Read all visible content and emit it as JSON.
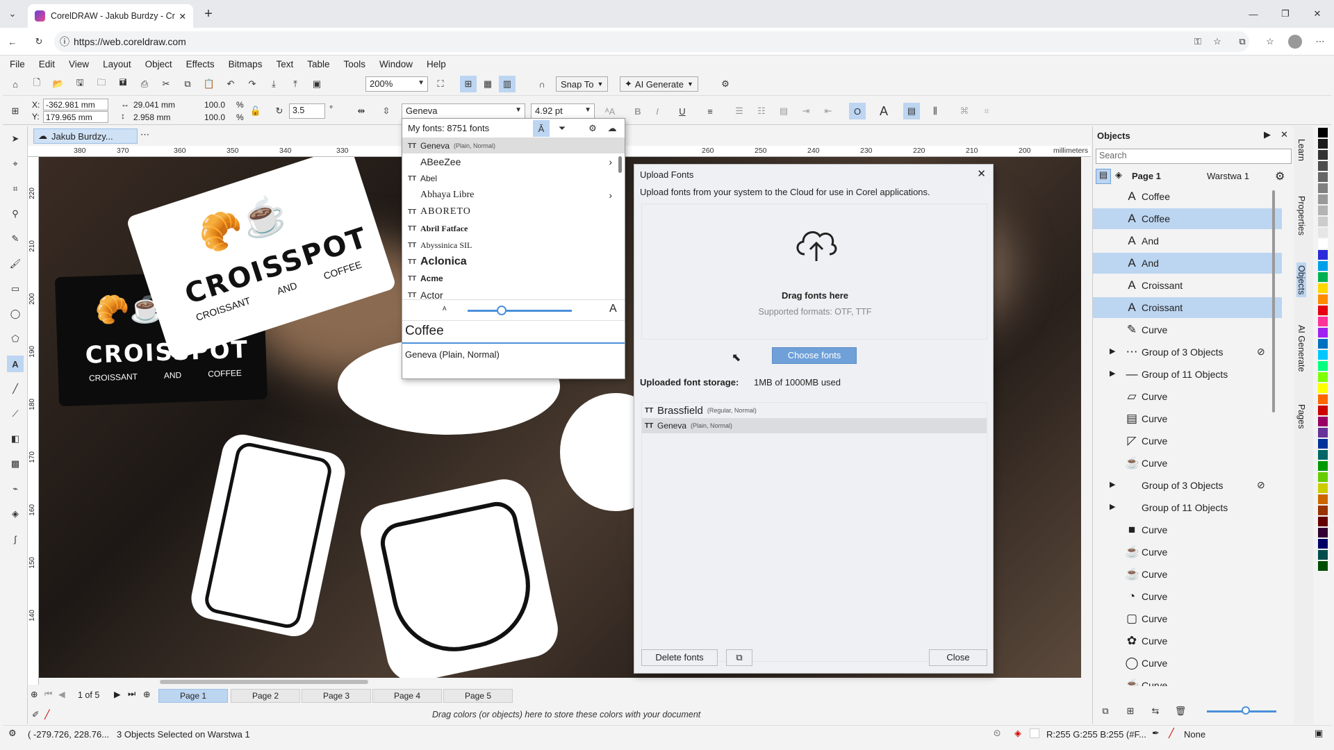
{
  "browser": {
    "tab_title": "CorelDRAW - Jakub Burdzy - Crois",
    "url": "https://web.coreldraw.com"
  },
  "menu": [
    "File",
    "Edit",
    "View",
    "Layout",
    "Object",
    "Effects",
    "Bitmaps",
    "Text",
    "Table",
    "Tools",
    "Window",
    "Help"
  ],
  "toolbar": {
    "zoom": "200%",
    "snap": "Snap To",
    "ai_generate": "AI Generate"
  },
  "propbar": {
    "x": "-362.981 mm",
    "y": "179.965 mm",
    "w": "29.041 mm",
    "h": "2.958 mm",
    "sx": "100.0",
    "sy": "100.0",
    "pct": "%",
    "rotation": "3.5",
    "deg": "°",
    "font": "Geneva",
    "size": "4.92 pt"
  },
  "doc_tab": "Jakub Burdzy...",
  "ruler": {
    "h_ticks": [
      "380",
      "370",
      "360",
      "350",
      "340",
      "330",
      "260",
      "250",
      "240",
      "230",
      "220",
      "210",
      "200"
    ],
    "v_ticks": [
      "220",
      "210",
      "200",
      "190",
      "180",
      "170",
      "160",
      "150",
      "140"
    ],
    "units": "millimeters"
  },
  "canvas": {
    "card1": {
      "brand": "CROISSPOT",
      "sub": [
        "CROISSANT",
        "AND",
        "COFFEE"
      ]
    },
    "card2": {
      "brand": "CROISSPOT",
      "sub": [
        "CROISSANT",
        "AND",
        "COFFEE"
      ]
    }
  },
  "font_popup": {
    "header": "My fonts: 8751 fonts",
    "current": "Geneva",
    "current_style": "(Plain, Normal)",
    "fonts": [
      "ABeeZee",
      "Abel",
      "Abhaya Libre",
      "ABORETO",
      "Abril Fatface",
      "Abyssinica SIL",
      "Aclonica",
      "Acme",
      "Actor"
    ],
    "preview_text": "Coffee",
    "footer": "Geneva (Plain, Normal)"
  },
  "upload_dialog": {
    "title": "Upload Fonts",
    "description": "Upload fonts from your system to the Cloud for use in Corel applications.",
    "drag_label": "Drag fonts here",
    "formats": "Supported formats: OTF, TTF",
    "choose_button": "Choose fonts",
    "storage_label": "Uploaded font storage:",
    "storage_value": "1MB of 1000MB used",
    "uploaded": [
      {
        "name": "Brassfield",
        "style": "(Regular, Normal)"
      },
      {
        "name": "Geneva",
        "style": "(Plain, Normal)"
      }
    ],
    "delete_button": "Delete fonts",
    "close_button": "Close"
  },
  "objects_panel": {
    "title": "Objects",
    "search_placeholder": "Search",
    "page": "Page 1",
    "layer": "Warstwa 1",
    "items": [
      {
        "label": "Coffee",
        "icon": "A",
        "selected": false
      },
      {
        "label": "Coffee",
        "icon": "A",
        "selected": true
      },
      {
        "label": "And",
        "icon": "A",
        "selected": false
      },
      {
        "label": "And",
        "icon": "A",
        "selected": true
      },
      {
        "label": "Croissant",
        "icon": "A",
        "selected": false
      },
      {
        "label": "Croissant",
        "icon": "A",
        "selected": true
      },
      {
        "label": "Curve",
        "icon": "✎",
        "selected": false
      },
      {
        "label": "Group of 3 Objects",
        "icon": "⋯",
        "selected": false,
        "group": true,
        "hidden": true
      },
      {
        "label": "Group of 11 Objects",
        "icon": "—",
        "selected": false,
        "group": true
      },
      {
        "label": "Curve",
        "icon": "▱",
        "selected": false
      },
      {
        "label": "Curve",
        "icon": "▤",
        "selected": false
      },
      {
        "label": "Curve",
        "icon": "◸",
        "selected": false
      },
      {
        "label": "Curve",
        "icon": "☕",
        "selected": false
      },
      {
        "label": "Group of 3 Objects",
        "icon": "",
        "selected": false,
        "group": true,
        "hidden": true
      },
      {
        "label": "Group of 11 Objects",
        "icon": "",
        "selected": false,
        "group": true
      },
      {
        "label": "Curve",
        "icon": "■",
        "selected": false
      },
      {
        "label": "Curve",
        "icon": "☕",
        "selected": false
      },
      {
        "label": "Curve",
        "icon": "☕",
        "selected": false
      },
      {
        "label": "Curve",
        "icon": "◔",
        "selected": false
      },
      {
        "label": "Curve",
        "icon": "▢",
        "selected": false
      },
      {
        "label": "Curve",
        "icon": "✿",
        "selected": false
      },
      {
        "label": "Curve",
        "icon": "◯",
        "selected": false
      },
      {
        "label": "Curve",
        "icon": "☕",
        "selected": false
      }
    ]
  },
  "side_tabs": [
    "Learn",
    "Properties",
    "Objects",
    "AI Generate",
    "Pages"
  ],
  "pages": {
    "counter": "1 of 5",
    "tabs": [
      "Page 1",
      "Page 2",
      "Page 3",
      "Page 4",
      "Page 5"
    ]
  },
  "color_hint": "Drag colors (or objects) here to store these colors with your document",
  "status": {
    "coords": "( -279.726, 228.76...",
    "selection": "3 Objects Selected on Warstwa 1",
    "fill": "R:255 G:255 B:255 (#F...",
    "outline": "None"
  },
  "palette": [
    "#000000",
    "#1a1a1a",
    "#333333",
    "#4d4d4d",
    "#666666",
    "#808080",
    "#999999",
    "#b3b3b3",
    "#cccccc",
    "#e6e6e6",
    "#ffffff",
    "#2b2bd9",
    "#00a0e9",
    "#00b050",
    "#ffd700",
    "#ff8c00",
    "#e60012",
    "#ff3399",
    "#a020f0",
    "#0070c0",
    "#00c8ff",
    "#00ff7f",
    "#7fff00",
    "#ffff00",
    "#ff6600",
    "#cc0000",
    "#990066",
    "#663399",
    "#003399",
    "#006666",
    "#009900",
    "#66cc00",
    "#cccc00",
    "#cc6600",
    "#993300",
    "#660000",
    "#330033",
    "#000066",
    "#004d4d",
    "#004d00"
  ]
}
